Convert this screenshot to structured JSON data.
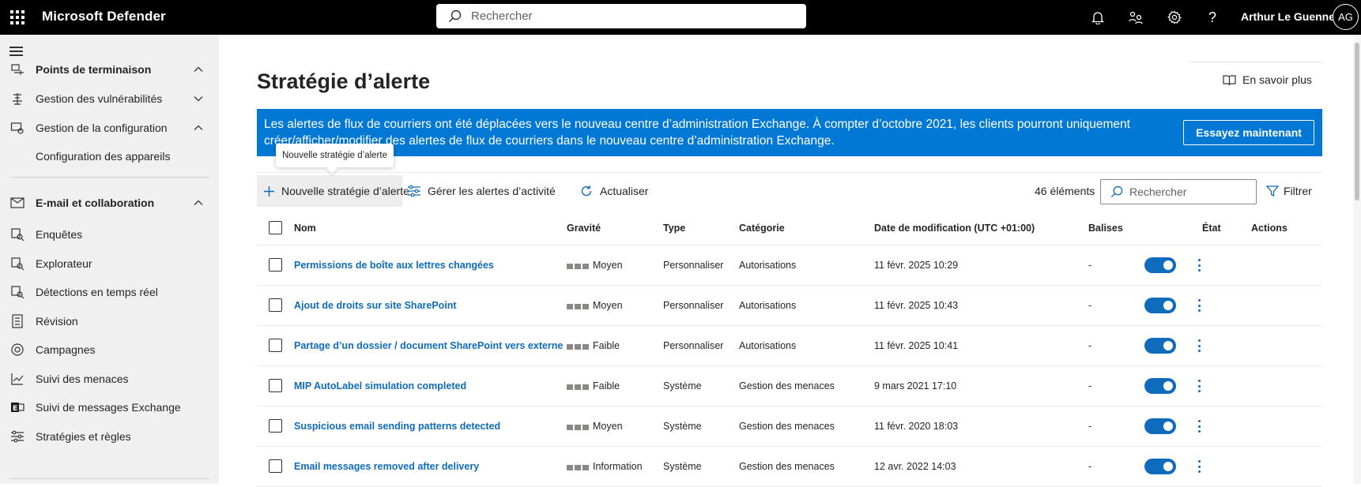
{
  "topbar": {
    "app_name": "Microsoft Defender",
    "search_placeholder": "Rechercher",
    "user_name": "Arthur Le Guennec",
    "user_initials": "AG"
  },
  "sidebar": {
    "items": [
      {
        "label": "Points de terminaison",
        "icon": "endpoint-icon",
        "expanded": true,
        "bold": true
      },
      {
        "label": "Gestion des vulnérabilités",
        "icon": "vulnerability-icon",
        "expanded": false
      },
      {
        "label": "Gestion de la configuration",
        "icon": "configuration-icon",
        "expanded": true
      },
      {
        "label": "Configuration des appareils",
        "sub": true
      },
      {
        "label": "E-mail et collaboration",
        "icon": "mail-icon",
        "expanded": true,
        "bold": true
      },
      {
        "label": "Enquêtes",
        "icon": "investigation-icon"
      },
      {
        "label": "Explorateur",
        "icon": "explorer-icon"
      },
      {
        "label": "Détections en temps réel",
        "icon": "realtime-icon"
      },
      {
        "label": "Révision",
        "icon": "review-icon"
      },
      {
        "label": "Campagnes",
        "icon": "campaign-icon"
      },
      {
        "label": "Suivi des menaces",
        "icon": "threat-tracker-icon"
      },
      {
        "label": "Suivi de messages Exchange",
        "icon": "exchange-icon"
      },
      {
        "label": "Stratégies et règles",
        "icon": "policies-icon"
      }
    ]
  },
  "page": {
    "title": "Stratégie d’alerte",
    "learn_more": "En savoir plus",
    "banner_text": "Les alertes de flux de courriers ont été déplacées vers le nouveau centre d’administration Exchange. À compter d’octobre 2021, les clients pourront uniquement créer/afficher/modifier des alertes de flux de courriers dans le nouveau centre d’administration Exchange.",
    "banner_button": "Essayez maintenant",
    "tooltip": "Nouvelle stratégie d’alerte"
  },
  "toolbar": {
    "new_policy": "Nouvelle stratégie d’alerte",
    "manage_activity": "Gérer les alertes d’activité",
    "refresh": "Actualiser",
    "count": "46 éléments",
    "search_placeholder": "Rechercher",
    "filter": "Filtrer"
  },
  "table": {
    "columns": [
      "Nom",
      "Gravité",
      "Type",
      "Catégorie",
      "Date de modification (UTC +01:00)",
      "Balises",
      "État",
      "Actions"
    ],
    "rows": [
      {
        "name": "Permissions de boîte aux lettres changées",
        "severity": "Moyen",
        "type": "Personnaliser",
        "category": "Autorisations",
        "modified": "11 févr. 2025 10:29",
        "tags": "-",
        "enabled": true
      },
      {
        "name": "Ajout de droits sur site SharePoint",
        "severity": "Moyen",
        "type": "Personnaliser",
        "category": "Autorisations",
        "modified": "11 févr. 2025 10:43",
        "tags": "-",
        "enabled": true
      },
      {
        "name": "Partage d’un dossier / document SharePoint vers externe",
        "severity": "Faible",
        "type": "Personnaliser",
        "category": "Autorisations",
        "modified": "11 févr. 2025 10:41",
        "tags": "-",
        "enabled": true
      },
      {
        "name": "MIP AutoLabel simulation completed",
        "severity": "Faible",
        "type": "Système",
        "category": "Gestion des menaces",
        "modified": "9 mars 2021 17:10",
        "tags": "-",
        "enabled": true
      },
      {
        "name": "Suspicious email sending patterns detected",
        "severity": "Moyen",
        "type": "Système",
        "category": "Gestion des menaces",
        "modified": "11 févr. 2020 18:03",
        "tags": "-",
        "enabled": true
      },
      {
        "name": "Email messages removed after delivery",
        "severity": "Information",
        "type": "Système",
        "category": "Gestion des menaces",
        "modified": "12 avr. 2022 14:03",
        "tags": "-",
        "enabled": true
      }
    ]
  },
  "colors": {
    "accent": "#0f6cbd",
    "banner": "#0078d4",
    "topbar": "#000000",
    "sidebar": "#f0f0f0"
  }
}
